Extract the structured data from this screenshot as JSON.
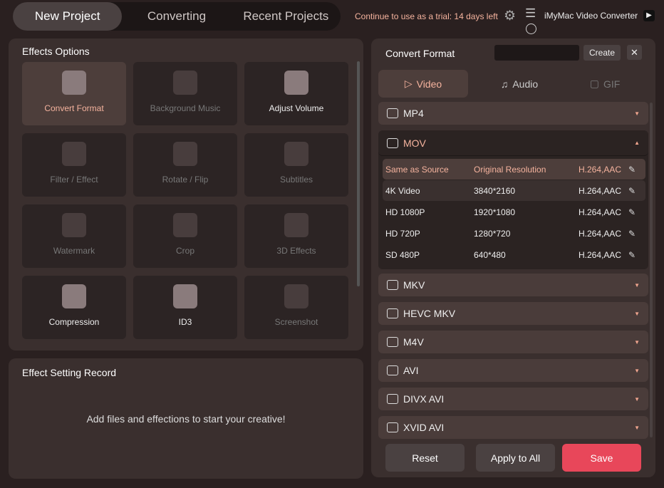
{
  "nav": {
    "tabs": [
      "New Project",
      "Converting",
      "Recent Projects"
    ],
    "active": 0
  },
  "header": {
    "trial": "Continue to use as a trial: 14 days left",
    "app_name": "iMyMac Video Converter"
  },
  "effects": {
    "title": "Effects Options",
    "tiles": [
      {
        "label": "Convert Format",
        "state": "active"
      },
      {
        "label": "Background Music",
        "state": "disabled"
      },
      {
        "label": "Adjust Volume",
        "state": "enabled"
      },
      {
        "label": "Filter / Effect",
        "state": "disabled"
      },
      {
        "label": "Rotate / Flip",
        "state": "disabled"
      },
      {
        "label": "Subtitles",
        "state": "disabled"
      },
      {
        "label": "Watermark",
        "state": "disabled"
      },
      {
        "label": "Crop",
        "state": "disabled"
      },
      {
        "label": "3D Effects",
        "state": "disabled"
      },
      {
        "label": "Compression",
        "state": "enabled"
      },
      {
        "label": "ID3",
        "state": "enabled"
      },
      {
        "label": "Screenshot",
        "state": "disabled"
      }
    ]
  },
  "record": {
    "title": "Effect Setting Record",
    "empty": "Add files and effections to start your creative!"
  },
  "convert": {
    "title": "Convert Format",
    "name_value": "",
    "create": "Create",
    "media_tabs": [
      "Video",
      "Audio",
      "GIF"
    ],
    "formats": [
      "MP4",
      "MOV",
      "MKV",
      "HEVC MKV",
      "M4V",
      "AVI",
      "DIVX AVI",
      "XVID AVI"
    ],
    "mov_presets": [
      {
        "name": "Same as Source",
        "res": "Original Resolution",
        "codec": "H.264,AAC"
      },
      {
        "name": "4K Video",
        "res": "3840*2160",
        "codec": "H.264,AAC"
      },
      {
        "name": "HD 1080P",
        "res": "1920*1080",
        "codec": "H.264,AAC"
      },
      {
        "name": "HD 720P",
        "res": "1280*720",
        "codec": "H.264,AAC"
      },
      {
        "name": "SD 480P",
        "res": "640*480",
        "codec": "H.264,AAC"
      }
    ],
    "reset": "Reset",
    "apply_all": "Apply to All",
    "save": "Save"
  },
  "colors": {
    "accent": "#f5b39e",
    "save": "#e8475a"
  }
}
